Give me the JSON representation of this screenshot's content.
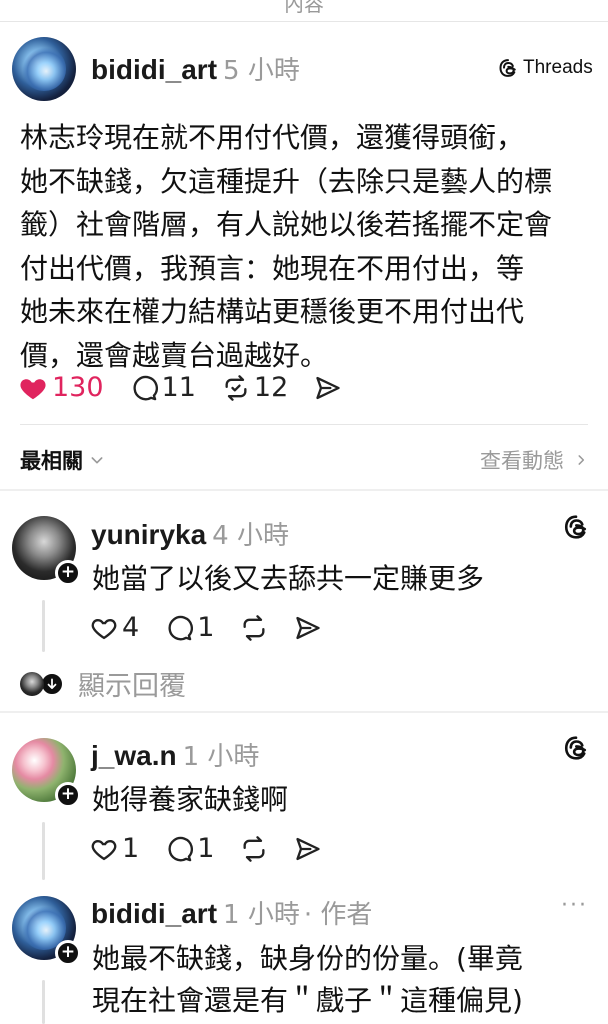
{
  "top": {
    "cut_text": "內容"
  },
  "post": {
    "username": "bididi_art",
    "time": "5 小時",
    "source_label": "Threads",
    "text_lines": [
      "林志玲現在就不用付代價，還獲得頭銜，",
      "她不缺錢，欠這種提升（去除只是藝人的標",
      "籤）社會階層，有人說她以後若搖擺不定會",
      "付出代價，我預言：她現在不用付出，等",
      "她未來在權力結構站更穩後更不用付出代",
      "價，還會越賣台過越好。"
    ],
    "likes": "130",
    "comments": "11",
    "reposts": "12",
    "like_color": "#e0245e"
  },
  "sort": {
    "label": "最相關",
    "activity": "查看動態"
  },
  "replies": [
    {
      "username": "yuniryka",
      "time": "4 小時",
      "text": "她當了以後又去舔共一定賺更多",
      "likes": "4",
      "comments": "1"
    },
    {
      "username": "j_wa.n",
      "time": "1 小時",
      "text": "她得養家缺錢啊",
      "likes": "1",
      "comments": "1"
    },
    {
      "username": "bididi_art",
      "time": "1 小時",
      "author_tag": "· 作者",
      "text_lines": [
        "她最不缺錢，缺身份的份量。(畢竟",
        "現在社會還是有＂戲子＂這種偏見)"
      ]
    }
  ],
  "show_replies": "顯示回覆",
  "more": "···"
}
